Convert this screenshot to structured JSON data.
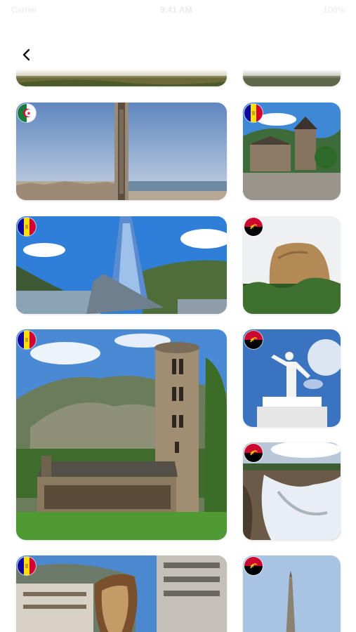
{
  "status_bar": {
    "carrier": "Carrier",
    "time": "9:41 AM",
    "battery": "100%"
  },
  "nav": {
    "back_icon": "chevron-left-icon"
  },
  "gallery": {
    "cards": [
      {
        "country": "Algeria",
        "flag": "algeria-flag-icon",
        "scene": "city-tower"
      },
      {
        "country": "Andorra",
        "flag": "andorra-flag-icon",
        "scene": "stone-church"
      },
      {
        "country": "Andorra",
        "flag": "andorra-flag-icon",
        "scene": "glass-spa"
      },
      {
        "country": "Angola",
        "flag": "angola-flag-icon",
        "scene": "rock-monolith"
      },
      {
        "country": "Andorra",
        "flag": "andorra-flag-icon",
        "scene": "romanesque-church"
      },
      {
        "country": "Angola",
        "flag": "angola-flag-icon",
        "scene": "christ-statue"
      },
      {
        "country": "Angola",
        "flag": "angola-flag-icon",
        "scene": "waterfall"
      },
      {
        "country": "Andorra",
        "flag": "andorra-flag-icon",
        "scene": "melting-clock-sculpture"
      },
      {
        "country": "Angola",
        "flag": "angola-flag-icon",
        "scene": "obelisk-monument"
      }
    ]
  }
}
